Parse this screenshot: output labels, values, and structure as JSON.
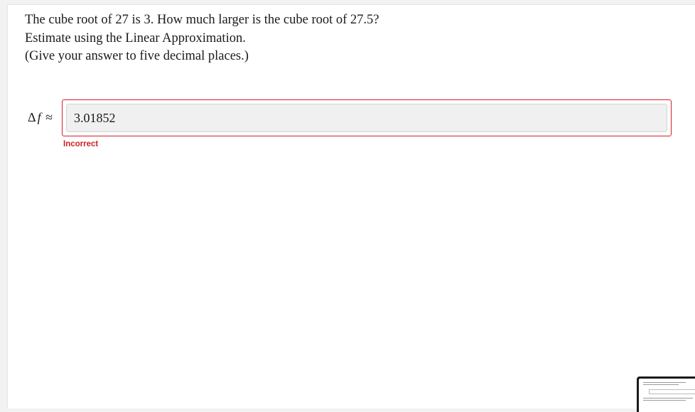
{
  "question": {
    "line1": "The cube root of 27 is 3. How much larger is the cube root of 27.5?",
    "line2": "Estimate using the Linear Approximation.",
    "line3": "(Give your answer to five decimal places.)"
  },
  "answer": {
    "delta_symbol": "Δ",
    "variable": "f",
    "approx_symbol": "≈",
    "value": "3.01852",
    "status": "Incorrect"
  },
  "colors": {
    "error": "#cf2026",
    "input_bg": "#f0f0f0"
  }
}
